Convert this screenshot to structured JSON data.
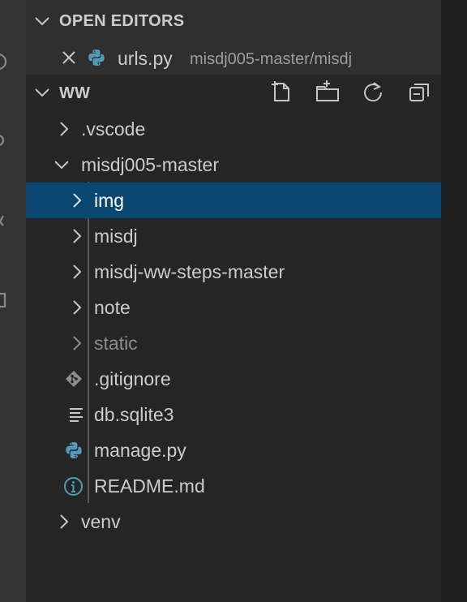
{
  "open_editors": {
    "title": "OPEN EDITORS",
    "items": [
      {
        "label": "urls.py",
        "description": "misdj005-master/misdj",
        "icon": "python-icon",
        "close_icon": "close-icon"
      }
    ]
  },
  "workspace": {
    "title": "WW",
    "actions": [
      "new-file-icon",
      "new-folder-icon",
      "refresh-icon",
      "collapse-all-icon"
    ]
  },
  "tree": [
    {
      "label": ".vscode",
      "type": "folder",
      "expanded": false
    },
    {
      "label": "misdj005-master",
      "type": "folder",
      "expanded": true
    },
    {
      "label": "img",
      "type": "folder",
      "expanded": false,
      "selected": true
    },
    {
      "label": "misdj",
      "type": "folder",
      "expanded": false
    },
    {
      "label": "misdj-ww-steps-master",
      "type": "folder",
      "expanded": false
    },
    {
      "label": "note",
      "type": "folder",
      "expanded": false
    },
    {
      "label": "static",
      "type": "folder",
      "expanded": false,
      "dimmed": true
    },
    {
      "label": ".gitignore",
      "type": "file",
      "icon": "git-icon"
    },
    {
      "label": "db.sqlite3",
      "type": "file",
      "icon": "lines-icon"
    },
    {
      "label": "manage.py",
      "type": "file",
      "icon": "python-icon"
    },
    {
      "label": "README.md",
      "type": "file",
      "icon": "info-icon"
    },
    {
      "label": "venv",
      "type": "folder",
      "expanded": false
    }
  ],
  "colors": {
    "sidebar_bg": "#252526",
    "selection_bg": "#094771",
    "text": "#cccccc",
    "python_blue": "#519aba",
    "git_gray": "#8d8d8d"
  }
}
